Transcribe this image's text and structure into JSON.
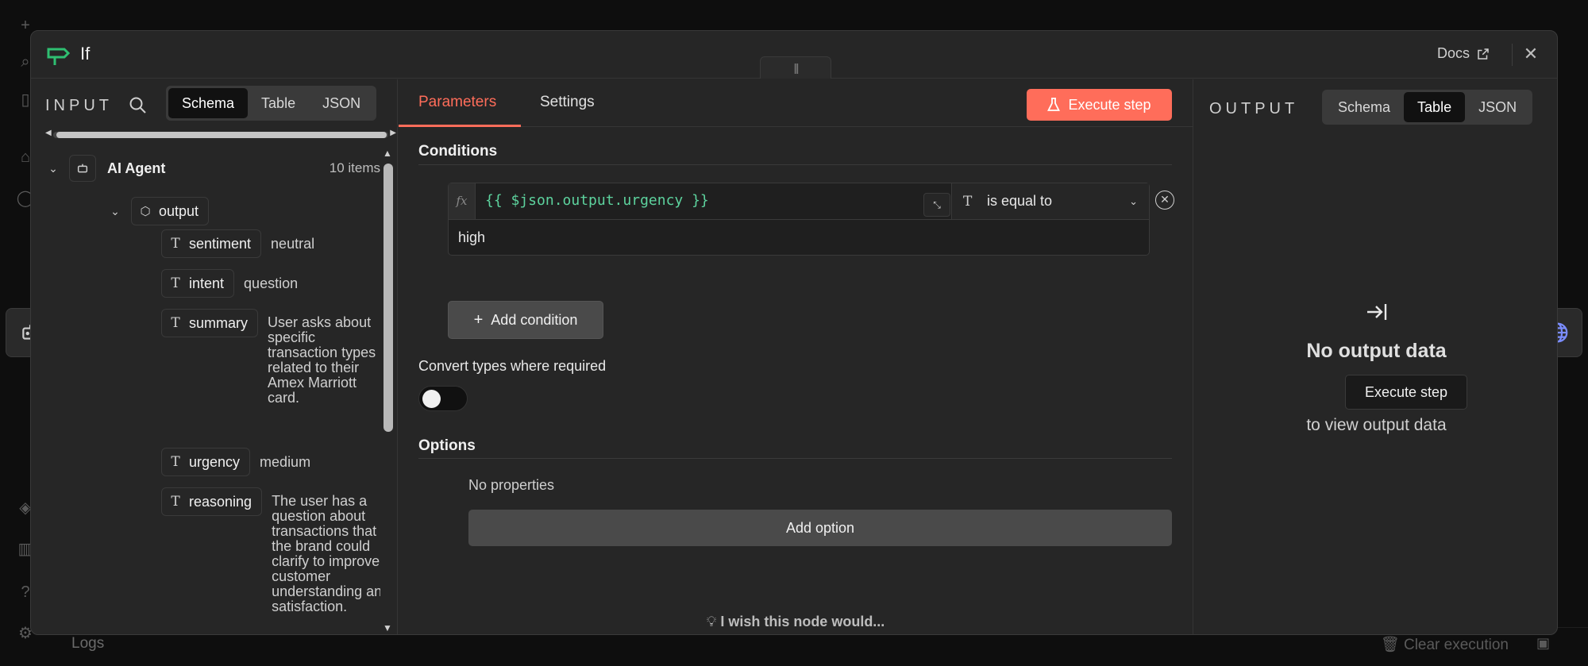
{
  "background": {
    "logs_label": "Logs",
    "clear_label": "Clear execution"
  },
  "modal": {
    "title": "If",
    "docs_label": "Docs",
    "drag_handle": "|||"
  },
  "input": {
    "label": "INPUT",
    "view_tabs": [
      "Schema",
      "Table",
      "JSON"
    ],
    "active_view": "Schema",
    "root": {
      "label": "AI Agent",
      "count": "10 items"
    },
    "output_key": "output",
    "fields": [
      {
        "key": "sentiment",
        "value": "neutral"
      },
      {
        "key": "intent",
        "value": "question"
      },
      {
        "key": "summary",
        "value": "User asks about specific transaction types related to their Amex Marriott card."
      },
      {
        "key": "urgency",
        "value": "medium"
      },
      {
        "key": "reasoning",
        "value": "The user has a question about transactions that the brand could clarify to improve customer understanding and satisfaction."
      }
    ]
  },
  "params": {
    "tabs": [
      "Parameters",
      "Settings"
    ],
    "active_tab": "Parameters",
    "execute_label": "Execute step",
    "conditions_title": "Conditions",
    "condition": {
      "fx": "fx",
      "expression": "{{ $json.output.urgency }}",
      "operator": "is equal to",
      "value": "high"
    },
    "add_condition_label": "Add condition",
    "convert_label": "Convert types where required",
    "convert_enabled": false,
    "options_title": "Options",
    "no_properties": "No properties",
    "add_option_label": "Add option",
    "wish_label": "I wish this node would..."
  },
  "output": {
    "label": "OUTPUT",
    "view_tabs": [
      "Schema",
      "Table",
      "JSON"
    ],
    "active_view": "Table",
    "empty_title": "No output data",
    "execute_label": "Execute step",
    "empty_hint": "to view output data"
  },
  "colors": {
    "accent": "#ff6d5a",
    "node_icon": "#2fbf71",
    "expression": "#5dd39e",
    "globe": "#7b8dff"
  }
}
